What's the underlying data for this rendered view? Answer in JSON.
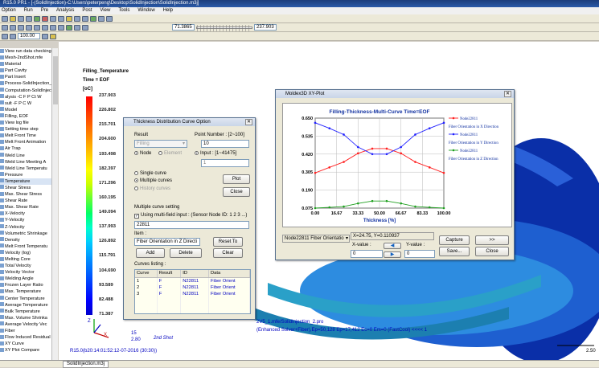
{
  "window": {
    "title": "R15.0 PR1 - [-(SolidInjection)-C:\\Users\\peterpeng\\Desktop\\SolidInjection\\SolidInjection.m3j]"
  },
  "menu": [
    "Option",
    "Run",
    "Pre",
    "Analysis",
    "Post",
    "View",
    "Tools",
    "Window",
    "Help"
  ],
  "toolbar": {
    "zoom_value": "100.00",
    "coord1": "71.3865",
    "coord2": "237.903"
  },
  "tree": {
    "items": [
      "View run data checking",
      "Mesh-2ndShot.mfe",
      "Material",
      "Part Cavity",
      "Part Insert",
      "Process-SolidInjection_",
      "Computation-SolidInject",
      "alysis -C F P Ct W",
      "sult -F P C W",
      "Model",
      "Filling, EOF",
      "View log file",
      "Setting time step",
      "Melt Front Time",
      "Melt Front Animation",
      "Air Trap",
      "Weld Line",
      "Weld Line Meeting A",
      "Weld Line Temperatu",
      "Pressure",
      "Temperature",
      "Shear Stress",
      "Max. Shear Stress",
      "Shear Rate",
      "Max. Shear Rate",
      "X-Velocity",
      "Y-Velocity",
      "Z-Velocity",
      "Volumetric Shrinkage",
      "Density",
      "Melt Front Temperatu",
      "Velocity (log)",
      "Melting Core",
      "Total Velocity",
      "Velocity Vector",
      "Welding Angle",
      "Frozen Layer Ratio",
      "Max. Temperature",
      "Center Temperature",
      "Average Temperature",
      "Bulk Temperature",
      "Max. Volume Shrinka",
      "Average Velocity Vec",
      "Fiber",
      "Flow Induced Residual",
      "XY Curve",
      "XY Plot Compare"
    ],
    "selected_index": 20
  },
  "legend": {
    "title": "Filling_Temperature",
    "time": "Time = EOF",
    "unit": "[oC]",
    "values": [
      "237.903",
      "226.802",
      "215.701",
      "204.600",
      "193.498",
      "182.397",
      "171.296",
      "160.195",
      "149.094",
      "137.993",
      "126.892",
      "115.791",
      "104.690",
      "93.589",
      "82.488",
      "71.387"
    ],
    "colors": [
      "#ff0000",
      "#ff3300",
      "#ff6600",
      "#ff9900",
      "#ffcc00",
      "#ffff00",
      "#ccff00",
      "#66ff33",
      "#00ff66",
      "#00ffcc",
      "#00ccff",
      "#0099ff",
      "#0066ff",
      "#0033ff",
      "#0000ff",
      "#0000cc"
    ]
  },
  "viewport": {
    "solver_line1": "2V5_1.mfe/SolidInjection_2.pro",
    "solver_line2": "(Enhanced Solver+Fiber),Ep=50,128 Ep=17,412 Ec=0 Em=0 (FastCool)  <<<< 1",
    "shot_label": "2nd Shot",
    "footer": "R15.0(b20:14:01:52:12-07-2016 (30:30))",
    "axis_z": "Z",
    "axis_y": "Y",
    "axis_x": "X",
    "scale_label": "2.80",
    "scale_num": "15",
    "right_scale": "2.50"
  },
  "tdc_dialog": {
    "title": "Thickness Distribution Curve Option",
    "result_label": "Result",
    "result_value": "Filling",
    "node_label": "Node",
    "element_label": "Element",
    "point_number_label": "Point Number : [2~100]",
    "point_number_value": "10",
    "input_label": "Input : [1~41475]",
    "input_value": "1",
    "single_curve": "Single curve",
    "multiple_curves": "Multiple curves",
    "history_curves": "History curves",
    "plot_button": "Plot",
    "close_button": "Close",
    "multi_setting_label": "Multiple curve setting",
    "multi_field_label": "Using multi-field input : (Sensor Node ID: 1 2 3 ...)",
    "multi_field_value": "22811",
    "item_label": "Item :",
    "item_value": "Fiber Orientation in Z Directi",
    "reset_button": "Reset To",
    "add_button": "Add",
    "delete_button": "Delete",
    "clear_button": "Clear",
    "curves_listing_label": "Curves listing :",
    "table_headers": [
      "Curve",
      "Result",
      "ID",
      "Data"
    ],
    "table_rows": [
      [
        "1",
        "F",
        "N22811",
        "Fiber Orient"
      ],
      [
        "2",
        "F",
        "N22811",
        "Fiber Orient"
      ],
      [
        "3",
        "F",
        "N22811",
        "Fiber Orient"
      ]
    ]
  },
  "xy_dialog": {
    "title": "Moldex3D XY-Plot",
    "chart_title": "Filling-Thickness-Multi-Curve Time=EOF",
    "xlabel": "Thickness [%]",
    "legend": [
      "Node22811",
      "Fiber Orientation in X Direction",
      "Node22811",
      "Fiber Orientation in Y Direction",
      "Node22811",
      "Fiber Orientation in Z Direction"
    ],
    "node_select": "Node22811 Fiber Orientatio",
    "cursor_readout": "X=24.75, Y=0.110937",
    "x_value_label": "X-value :",
    "x_value": "0",
    "y_value_label": "Y-value :",
    "y_value": "0",
    "capture_button": "Capture",
    "next_button": ">>",
    "save_button": "Save...",
    "close_button": "Close"
  },
  "chart_data": {
    "type": "line",
    "title": "Filling-Thickness-Multi-Curve Time=EOF",
    "xlabel": "Thickness [%]",
    "ylabel": "",
    "xlim": [
      0,
      100
    ],
    "ylim": [
      0.075,
      0.65
    ],
    "xticks": [
      "0.00",
      "16.67",
      "33.33",
      "50.00",
      "66.67",
      "83.33",
      "100.00"
    ],
    "yticks": [
      "0.650",
      "0.535",
      "0.420",
      "0.305",
      "0.190",
      "0.075"
    ],
    "x": [
      0,
      11.1,
      22.2,
      33.3,
      44.4,
      55.6,
      66.7,
      77.8,
      88.9,
      100
    ],
    "series": [
      {
        "name": "Fiber Orientation in X Direction",
        "color": "#ff2020",
        "values": [
          0.3,
          0.335,
          0.37,
          0.425,
          0.455,
          0.455,
          0.425,
          0.37,
          0.335,
          0.3
        ]
      },
      {
        "name": "Fiber Orientation in Y Direction",
        "color": "#2020ff",
        "values": [
          0.62,
          0.585,
          0.545,
          0.465,
          0.42,
          0.42,
          0.465,
          0.545,
          0.585,
          0.62
        ]
      },
      {
        "name": "Fiber Orientation in Z Direction",
        "color": "#20a020",
        "values": [
          0.075,
          0.08,
          0.085,
          0.105,
          0.12,
          0.12,
          0.105,
          0.085,
          0.08,
          0.075
        ]
      }
    ],
    "grid": true,
    "legend_position": "right"
  },
  "statusbar": {
    "tab": "SolidInjection.m3j"
  }
}
